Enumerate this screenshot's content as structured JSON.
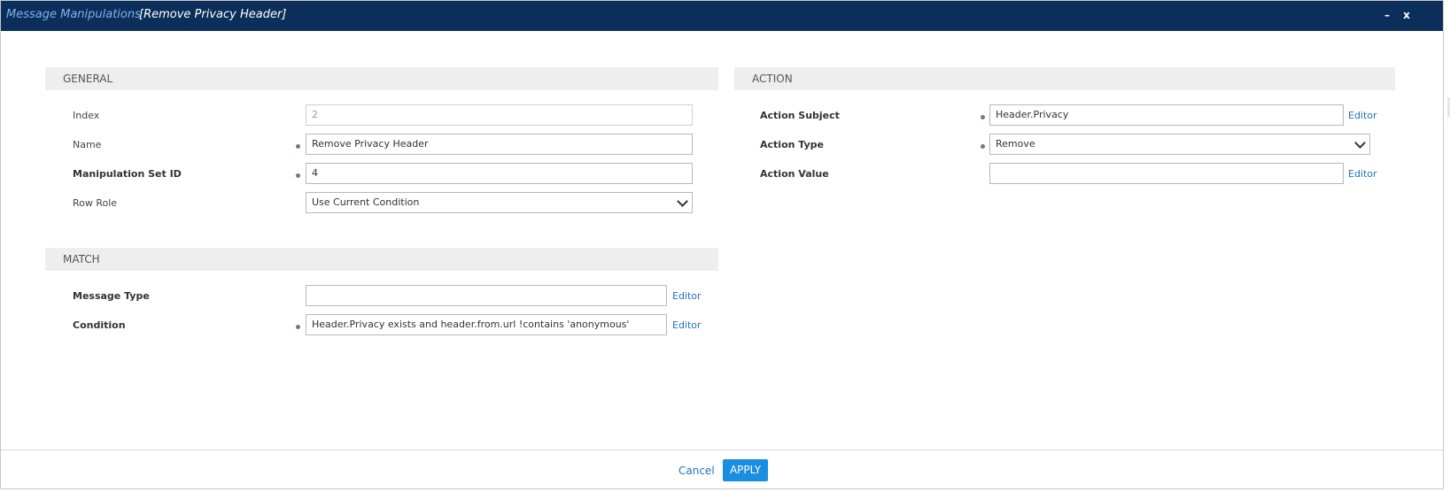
{
  "window": {
    "title": "Message Manipulations",
    "subtitle": "[Remove Privacy Header]",
    "minimize_label": "–",
    "close_label": "x"
  },
  "general": {
    "header": "GENERAL",
    "fields": {
      "index": {
        "label": "Index",
        "value": "2"
      },
      "name": {
        "label": "Name",
        "value": "Remove Privacy Header"
      },
      "manipulation_set_id": {
        "label": "Manipulation Set ID",
        "value": "4"
      },
      "row_role": {
        "label": "Row Role",
        "value": "Use Current Condition"
      }
    }
  },
  "match": {
    "header": "MATCH",
    "fields": {
      "message_type": {
        "label": "Message Type",
        "value": "",
        "editor_label": "Editor"
      },
      "condition": {
        "label": "Condition",
        "value": "Header.Privacy exists and header.from.url !contains 'anonymous'",
        "editor_label": "Editor"
      }
    }
  },
  "action": {
    "header": "ACTION",
    "fields": {
      "action_subject": {
        "label": "Action Subject",
        "value": "Header.Privacy",
        "editor_label": "Editor"
      },
      "action_type": {
        "label": "Action Type",
        "value": "Remove"
      },
      "action_value": {
        "label": "Action Value",
        "value": "",
        "editor_label": "Editor"
      }
    }
  },
  "footer": {
    "cancel_label": "Cancel",
    "apply_label": "APPLY"
  },
  "colors": {
    "titlebar": "#0b2f5a",
    "title_accent": "#7fb1ea",
    "link": "#1e73be",
    "apply_button": "#1a8ee1"
  }
}
